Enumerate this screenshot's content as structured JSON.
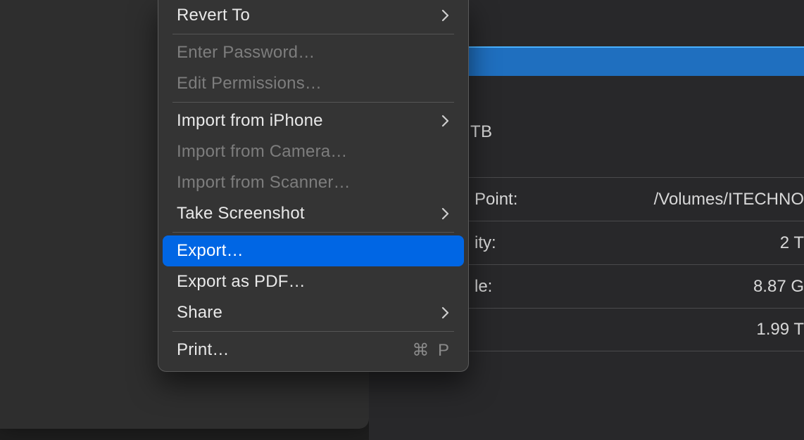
{
  "menu": {
    "revert_to": "Revert To",
    "enter_password": "Enter Password…",
    "edit_permissions": "Edit Permissions…",
    "import_iphone": "Import from iPhone",
    "import_camera": "Import from Camera…",
    "import_scanner": "Import from Scanner…",
    "take_screenshot": "Take Screenshot",
    "export": "Export…",
    "export_pdf": "Export as PDF…",
    "share": "Share",
    "print": "Print…",
    "print_shortcut": "⌘ P"
  },
  "info": {
    "tb_fragment": "TB",
    "rows": [
      {
        "label_fragment": "Point:",
        "value_fragment": "/Volumes/ITECHNO"
      },
      {
        "label_fragment": "ity:",
        "value_fragment": "2 T"
      },
      {
        "label_fragment": "le:",
        "value_fragment": "8.87 G"
      },
      {
        "label_fragment": "",
        "value_fragment": "1.99 T"
      }
    ]
  }
}
